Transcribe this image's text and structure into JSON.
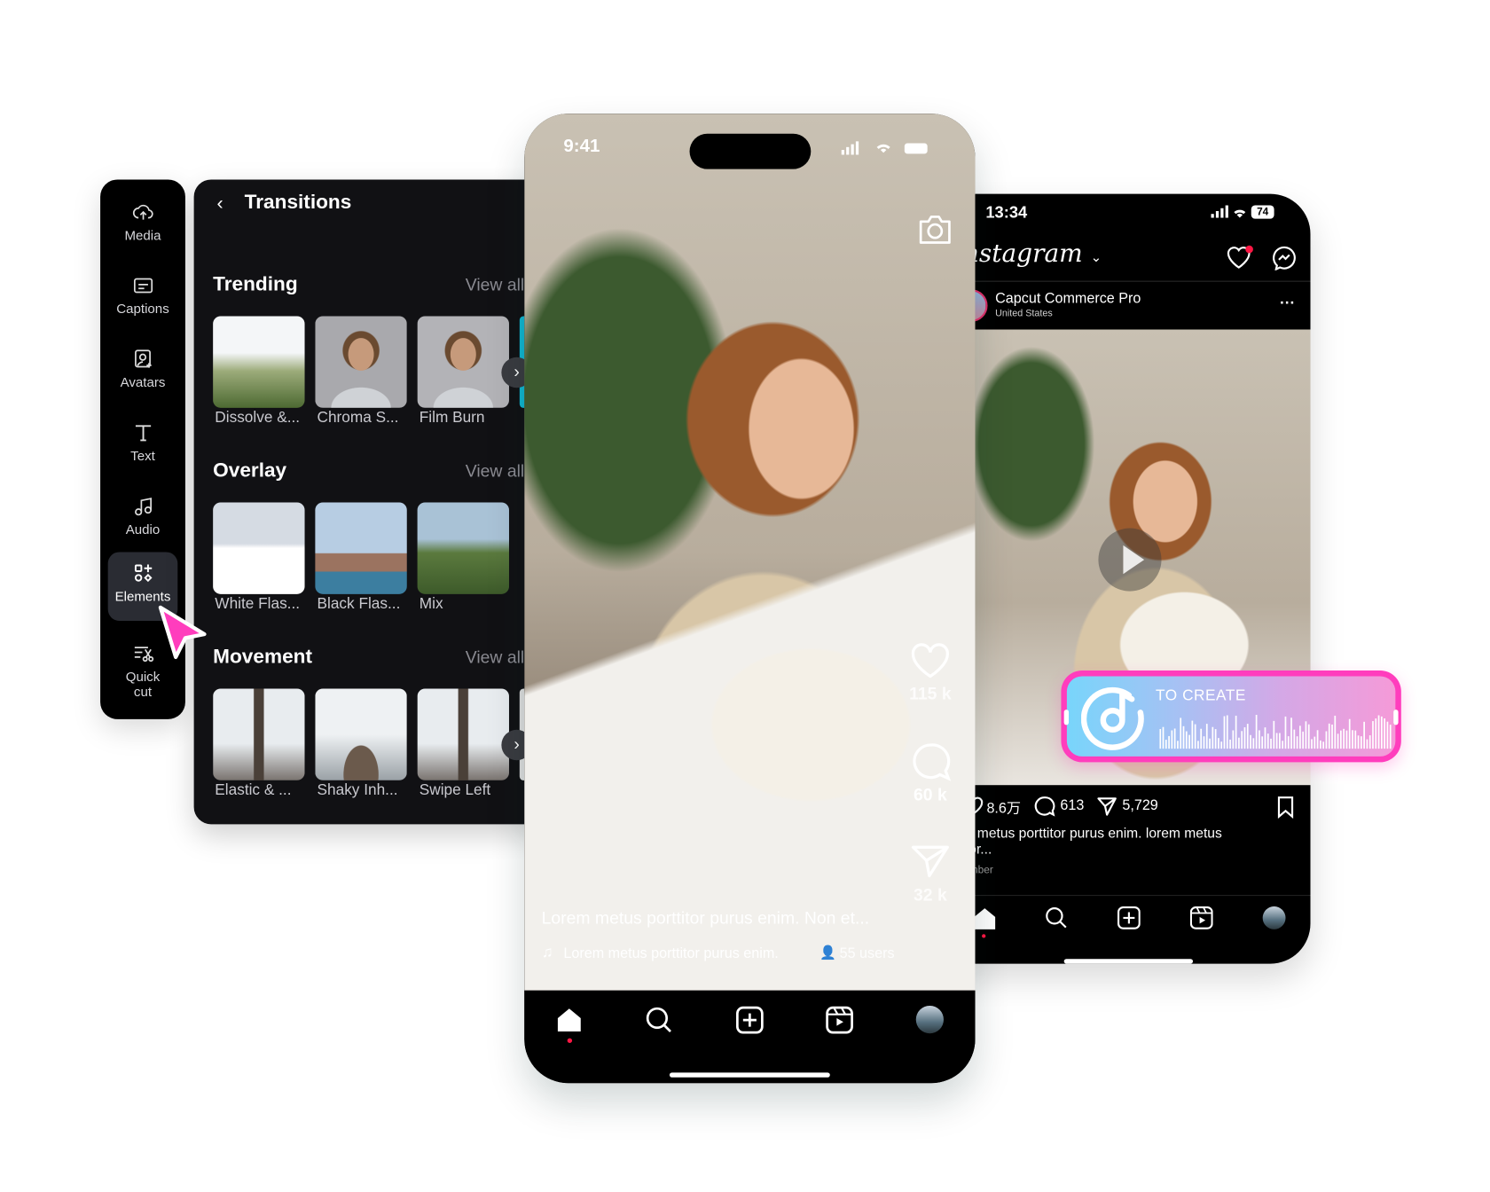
{
  "sidebar": {
    "items": [
      {
        "label": "Media",
        "icon": "cloud-upload-icon"
      },
      {
        "label": "Captions",
        "icon": "captions-icon"
      },
      {
        "label": "Avatars",
        "icon": "avatar-icon"
      },
      {
        "label": "Text",
        "icon": "text-icon"
      },
      {
        "label": "Audio",
        "icon": "music-note-icon"
      },
      {
        "label": "Elements",
        "icon": "elements-icon",
        "active": true
      },
      {
        "label": "Quick cut",
        "label_line1": "Quick",
        "label_line2": "cut",
        "icon": "quick-cut-icon"
      }
    ]
  },
  "panel": {
    "title": "Transitions",
    "sections": [
      {
        "title": "Trending",
        "view_all": "View all",
        "items": [
          "Dissolve &...",
          "Chroma S...",
          "Film Burn"
        ]
      },
      {
        "title": "Overlay",
        "view_all": "View all",
        "items": [
          "White Flas...",
          "Black Flas...",
          "Mix"
        ]
      },
      {
        "title": "Movement",
        "view_all": "View all",
        "items": [
          "Elastic & ...",
          "Shaky Inh...",
          "Swipe Left"
        ]
      }
    ]
  },
  "tiktok": {
    "time": "9:41",
    "likes": "115 k",
    "comments": "60 k",
    "shares": "32 k",
    "caption": "Lorem metus porttitor purus enim. Non et...",
    "music": "Lorem metus porttitor purus enim.",
    "users": "55 users",
    "nav": [
      "home",
      "search",
      "create",
      "reels",
      "profile"
    ]
  },
  "instagram": {
    "time": "13:34",
    "battery": "74",
    "logo": "Instagram",
    "account": "Capcut Commerce Pro",
    "location": "United States",
    "likes": "8.6万",
    "comments": "613",
    "shares": "5,729",
    "caption": "Lorem metus porttitor purus enim. lorem metus porttitor...",
    "date": "September"
  },
  "sticker": {
    "label": "TO CREATE"
  },
  "colors": {
    "accent_pink": "#ff3dbd",
    "notification_red": "#ff1744",
    "panel_bg": "#111114"
  }
}
